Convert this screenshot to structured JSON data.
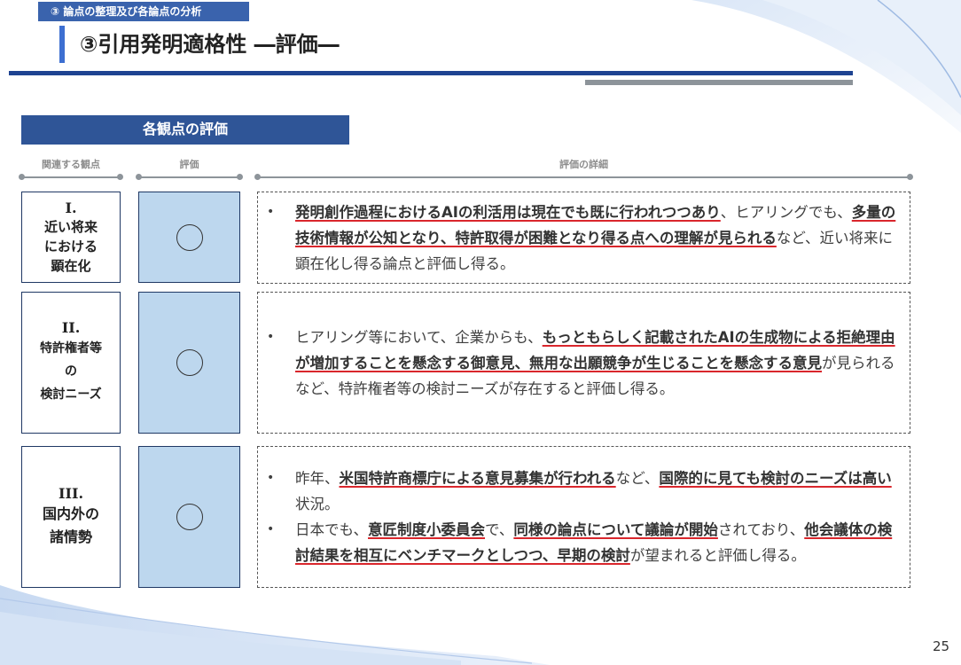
{
  "section_tag": "③ 論点の整理及び各論点の分析",
  "title": "③引用発明適格性 ―評価―",
  "table_header": "各観点の評価",
  "columns": {
    "aspect": "関連する観点",
    "rating": "評価",
    "detail": "評価の詳細"
  },
  "rows": [
    {
      "num": "I.",
      "name": "近い将来\nにおける\n顕在化",
      "rating": "○",
      "bullets": [
        [
          {
            "t": "発明創作過程におけるAIの利活用は現在でも既に行われつつあり",
            "u": true
          },
          {
            "t": "、ヒアリングでも、",
            "u": false
          },
          {
            "t": "多量の技術情報が公知となり、特許取得が困難となり得る点への理解が見られる",
            "u": true
          },
          {
            "t": "など、近い将来に顕在化し得る論点と評価し得る。",
            "u": false
          }
        ]
      ]
    },
    {
      "num": "II.",
      "name": "特許権者等\nの\n検討ニーズ",
      "rating": "○",
      "bullets": [
        [
          {
            "t": "ヒアリング等において、企業からも、",
            "u": false
          },
          {
            "t": "もっともらしく記載されたAIの生成物による拒絶理由が増加することを懸念する御意見、無用な出願競争が生じることを懸念する意見",
            "u": true
          },
          {
            "t": "が見られるなど、特許権者等の検討ニーズが存在すると評価し得る。",
            "u": false
          }
        ]
      ]
    },
    {
      "num": "III.",
      "name": "国内外の\n諸情勢",
      "rating": "○",
      "bullets": [
        [
          {
            "t": "昨年、",
            "u": false
          },
          {
            "t": "米国特許商標庁による意見募集が行われる",
            "u": true
          },
          {
            "t": "など、",
            "u": false
          },
          {
            "t": "国際的に見ても検討のニーズは高い",
            "u": true
          },
          {
            "t": "状況。",
            "u": false
          }
        ],
        [
          {
            "t": "日本でも、",
            "u": false
          },
          {
            "t": "意匠制度小委員会",
            "u": true
          },
          {
            "t": "で、",
            "u": false
          },
          {
            "t": "同様の論点について議論が開始",
            "u": true
          },
          {
            "t": "されており、",
            "u": false
          },
          {
            "t": "他会議体の検討結果を相互にベンチマークとしつつ、早期の検討",
            "u": true
          },
          {
            "t": "が望まれると評価し得る。",
            "u": false
          }
        ]
      ]
    }
  ],
  "page_number": "25",
  "colors": {
    "navy": "#1e4391",
    "header_blue": "#2f5597",
    "rating_fill": "#bdd7ee",
    "underline_red": "#d9262c"
  }
}
